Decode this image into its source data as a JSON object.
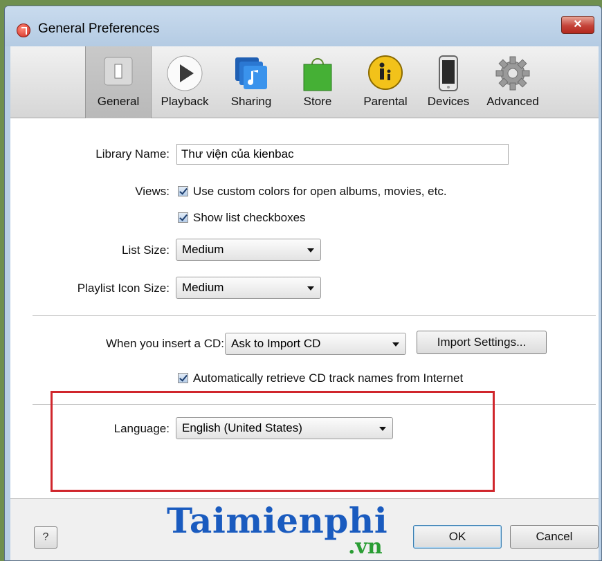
{
  "window": {
    "title": "General Preferences",
    "close_glyph": "✕",
    "app_icon": "itunes-icon"
  },
  "toolbar": {
    "tabs": [
      {
        "label": "General",
        "icon": "general-switch-icon",
        "active": true
      },
      {
        "label": "Playback",
        "icon": "play-icon",
        "active": false
      },
      {
        "label": "Sharing",
        "icon": "sharing-music-icon",
        "active": false
      },
      {
        "label": "Store",
        "icon": "store-bag-icon",
        "active": false
      },
      {
        "label": "Parental",
        "icon": "parental-icon",
        "active": false
      },
      {
        "label": "Devices",
        "icon": "device-phone-icon",
        "active": false
      },
      {
        "label": "Advanced",
        "icon": "gear-icon",
        "active": false
      }
    ]
  },
  "general": {
    "library_name_label": "Library Name:",
    "library_name_value": "Thư viện của kienbac",
    "views_label": "Views:",
    "custom_colors_label": "Use custom colors for open albums, movies, etc.",
    "custom_colors_checked": true,
    "show_checkboxes_label": "Show list checkboxes",
    "show_checkboxes_checked": true,
    "list_size_label": "List Size:",
    "list_size_value": "Medium",
    "playlist_icon_size_label": "Playlist Icon Size:",
    "playlist_icon_size_value": "Medium",
    "insert_cd_label": "When you insert a CD:",
    "insert_cd_value": "Ask to Import CD",
    "import_settings_label": "Import Settings...",
    "auto_retrieve_label": "Automatically retrieve CD track names from Internet",
    "auto_retrieve_checked": true,
    "language_label": "Language:",
    "language_value": "English (United States)"
  },
  "footer": {
    "help_label": "?",
    "ok_label": "OK",
    "cancel_label": "Cancel"
  },
  "watermark": {
    "main": "Taimienphi",
    "sub": ".vn"
  },
  "colors": {
    "highlight": "#d0262c",
    "watermark_blue": "#1a5bbf",
    "watermark_green": "#2a9d34"
  }
}
